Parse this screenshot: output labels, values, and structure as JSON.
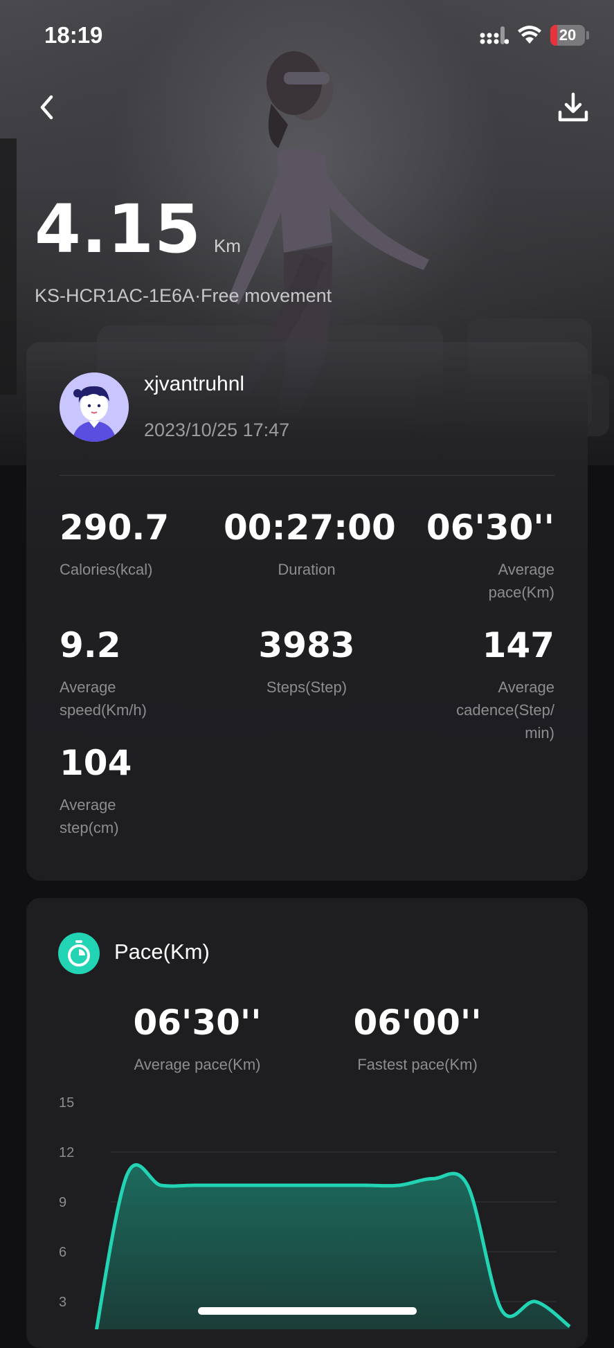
{
  "status_bar": {
    "time": "18:19",
    "battery": "20",
    "battery_level": 0.2
  },
  "header": {
    "back_icon": "chevron-left-icon",
    "download_icon": "download-icon"
  },
  "hero": {
    "distance_value": "4.15",
    "distance_unit": "Km",
    "subtitle": "KS-HCR1AC-1E6A·Free movement"
  },
  "profile": {
    "username": "xjvantruhnl",
    "datetime": "2023/10/25 17:47"
  },
  "stats": [
    {
      "value": "290.7",
      "label": "Calories(kcal)"
    },
    {
      "value": "00:27:00",
      "label": "Duration"
    },
    {
      "value": "06'30''",
      "label": "Average pace(Km)"
    },
    {
      "value": "9.2",
      "label": "Average speed(Km/h)"
    },
    {
      "value": "3983",
      "label": "Steps(Step)"
    },
    {
      "value": "147",
      "label": "Average cadence(Step/ min)"
    },
    {
      "value": "104",
      "label": "Average step(cm)"
    }
  ],
  "pace": {
    "title": "Pace(Km)",
    "icon": "stopwatch-icon",
    "average_value": "06'30''",
    "average_label": "Average pace(Km)",
    "fastest_value": "06'00''",
    "fastest_label": "Fastest pace(Km)"
  },
  "chart_data": {
    "type": "area",
    "title": "",
    "xlabel": "",
    "ylabel": "",
    "ylim": [
      0,
      15
    ],
    "yticks": [
      "15",
      "12",
      "9",
      "6",
      "3"
    ],
    "grid": true,
    "color": "#22d3b4",
    "series": [
      {
        "values": [
          0,
          10.6,
          10,
          10,
          10,
          10,
          10,
          10,
          10,
          10,
          10.4,
          10,
          2.5,
          3,
          1.5
        ]
      }
    ]
  }
}
